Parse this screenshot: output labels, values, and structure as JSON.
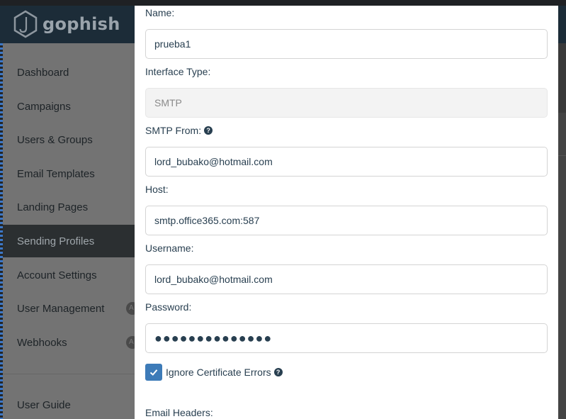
{
  "app": {
    "brand": "gophish",
    "sidebar": {
      "items": [
        {
          "label": "Dashboard"
        },
        {
          "label": "Campaigns"
        },
        {
          "label": "Users & Groups"
        },
        {
          "label": "Email Templates"
        },
        {
          "label": "Landing Pages"
        },
        {
          "label": "Sending Profiles",
          "active": true
        },
        {
          "label": "Account Settings"
        },
        {
          "label": "User Management",
          "badge": "A"
        },
        {
          "label": "Webhooks",
          "badge": "A"
        }
      ],
      "footer_item": "User Guide"
    }
  },
  "modal": {
    "name": {
      "label": "Name:",
      "value": "prueba1"
    },
    "interface_type": {
      "label": "Interface Type:",
      "value": "SMTP"
    },
    "smtp_from": {
      "label": "SMTP From:",
      "value": "lord_bubako@hotmail.com"
    },
    "host": {
      "label": "Host:",
      "value": "smtp.office365.com:587"
    },
    "username": {
      "label": "Username:",
      "value": "lord_bubako@hotmail.com"
    },
    "password": {
      "label": "Password:",
      "value": "●●●●●●●●●●●●●●"
    },
    "ignore_cert": {
      "label": "Ignore Certificate Errors",
      "checked": true
    },
    "email_headers": {
      "label": "Email Headers:"
    }
  },
  "colors": {
    "accent": "#3d7bb8",
    "navbar": "#1c2c38",
    "text": "#283f50"
  }
}
